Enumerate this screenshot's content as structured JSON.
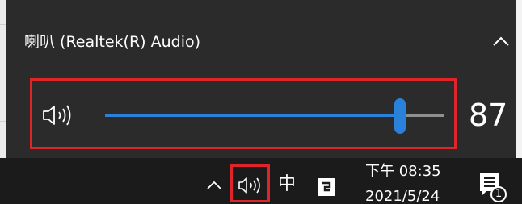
{
  "flyout": {
    "device_name": "喇叭 (Realtek(R) Audio)",
    "volume": {
      "value": 87,
      "value_label": "87"
    }
  },
  "taskbar": {
    "ime_label": "中",
    "clock": {
      "time": "下午 08:35",
      "date": "2021/5/24"
    },
    "notification_count": "1"
  },
  "colors": {
    "accent": "#2a81d9",
    "highlight_border": "#e0242c",
    "flyout_bg": "#2b2b2b",
    "taskbar_bg": "#1b1b1b"
  },
  "icons": {
    "collapse": "chevron-up-icon",
    "speaker": "speaker-icon",
    "tray_overflow": "chevron-up-icon",
    "tray_volume": "speaker-icon",
    "tray_app": "app-icon",
    "action_center": "notification-icon"
  }
}
